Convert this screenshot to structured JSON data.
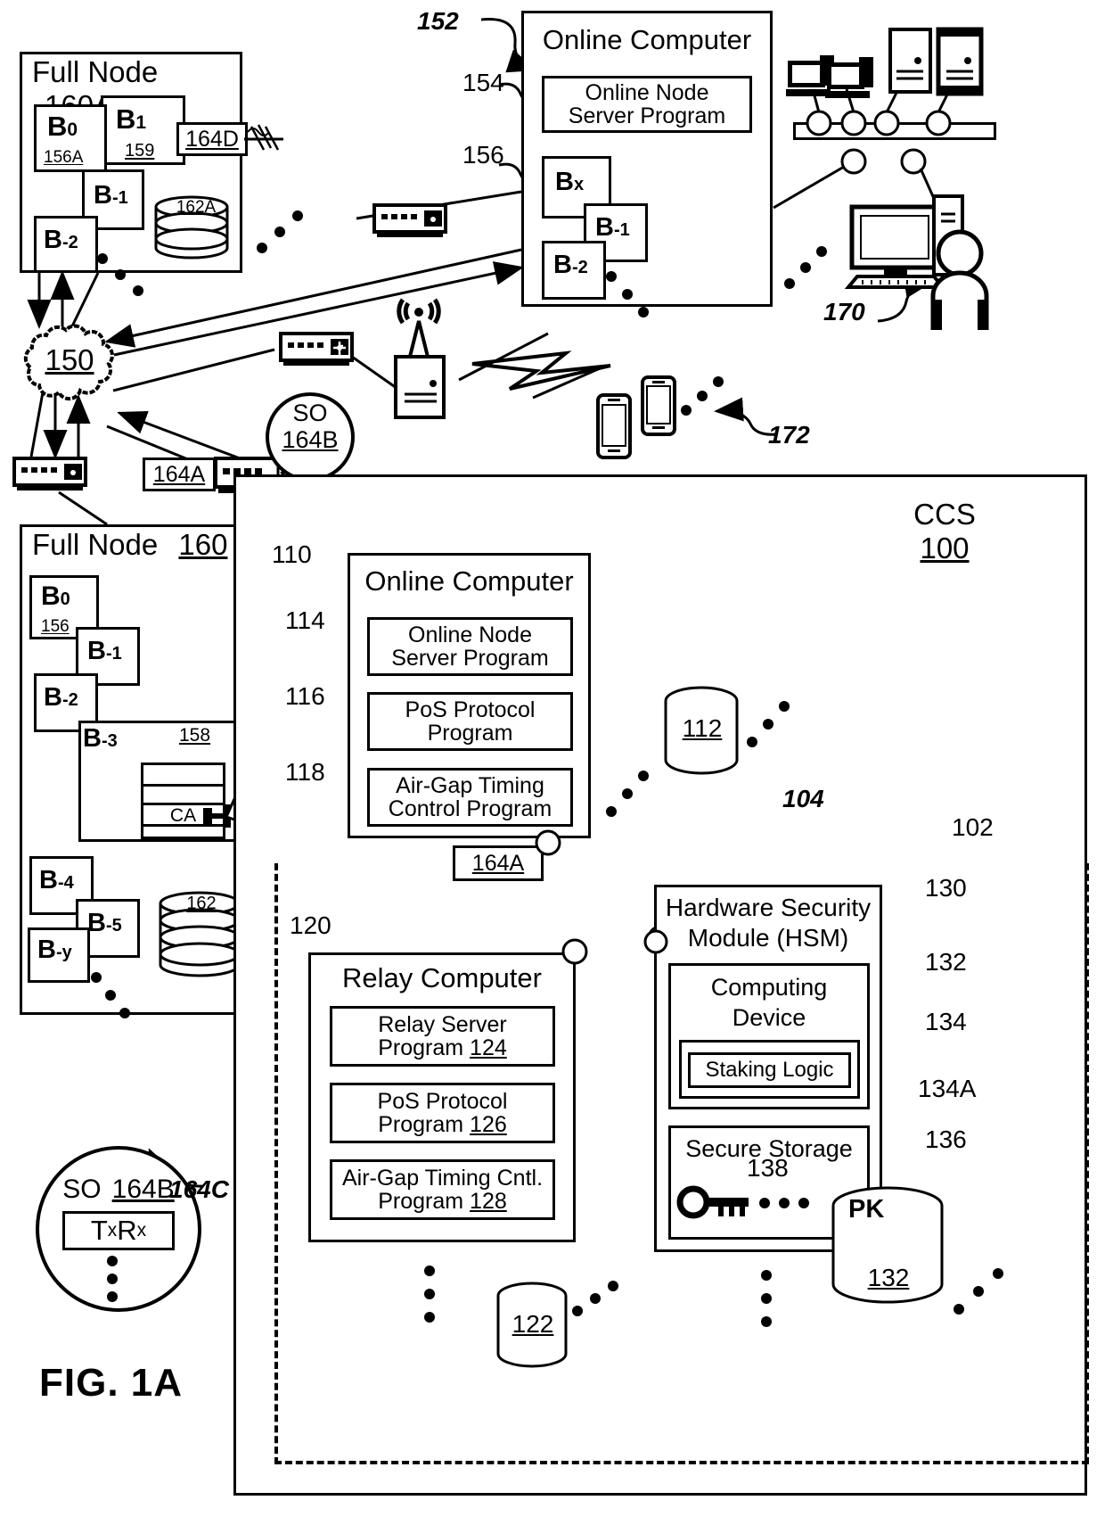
{
  "figure": {
    "label": "FIG. 1A"
  },
  "full_node_a": {
    "title": "Full Node",
    "ref": "160A",
    "blocks": [
      {
        "name": "B",
        "sub": "0",
        "ref": "156A"
      },
      {
        "name": "B",
        "sub": "1",
        "ref": "159"
      },
      {
        "name": "B",
        "sub": "-1",
        "ref": ""
      },
      {
        "name": "B",
        "sub": "-2",
        "ref": ""
      }
    ],
    "so_box": "164D",
    "db_ref": "162A"
  },
  "online_computer_top": {
    "ref": "152",
    "title": "Online Computer",
    "program": {
      "ref": "154",
      "label": "Online Node Server Program"
    },
    "chain_ref": "156",
    "blocks": [
      {
        "name": "B",
        "sub": "x"
      },
      {
        "name": "B",
        "sub": "-1"
      },
      {
        "name": "B",
        "sub": "-2"
      }
    ]
  },
  "network": {
    "cloud_ref": "150",
    "switch_164a": "164A",
    "so_circle": {
      "line1": "SO",
      "line2": "164B"
    }
  },
  "users": {
    "ref": "170"
  },
  "mobile": {
    "ref": "172"
  },
  "full_node_b": {
    "title": "Full Node",
    "ref": "160",
    "blocks": [
      {
        "name": "B",
        "sub": "0",
        "ref": "156"
      },
      {
        "name": "B",
        "sub": "-1",
        "ref": ""
      },
      {
        "name": "B",
        "sub": "-2",
        "ref": ""
      },
      {
        "name": "B",
        "sub": "-3",
        "ref": ""
      },
      {
        "name": "B",
        "sub": "-4",
        "ref": ""
      },
      {
        "name": "B",
        "sub": "-5",
        "ref": ""
      },
      {
        "name": "B",
        "sub": "-y",
        "ref": ""
      }
    ],
    "ledger_ref": "158",
    "ca_label": "CA",
    "db_ref": "162"
  },
  "so_164b_detail": {
    "title": "SO",
    "ref": "164B",
    "txrx": {
      "t": "T",
      "tsub": "x",
      "r": "R",
      "rsub": "x"
    },
    "callout": "164C"
  },
  "ccs": {
    "title": "CCS",
    "ref": "100",
    "airgap_ref": "102",
    "airgap_arrow_ref": "104",
    "switch_164a": "164A",
    "online_computer": {
      "ref": "110",
      "title": "Online Computer",
      "programs": [
        {
          "ref": "114",
          "label": "Online Node Server Program"
        },
        {
          "ref": "116",
          "label": "PoS Protocol Program"
        },
        {
          "ref": "118",
          "label": "Air-Gap Timing Control Program"
        }
      ],
      "db_ref": "112"
    },
    "relay_computer": {
      "ref": "120",
      "title": "Relay Computer",
      "programs": [
        {
          "label": "Relay Server Program",
          "ref": "124"
        },
        {
          "label": "PoS Protocol Program",
          "ref": "126"
        },
        {
          "label": "Air-Gap Timing Cntl. Program",
          "ref": "128"
        }
      ],
      "db_ref": "122"
    },
    "hsm": {
      "ref": "130",
      "title_line1": "Hardware Security",
      "title_line2": "Module (HSM)",
      "computing_device": {
        "ref": "132",
        "title_line1": "Computing",
        "title_line2": "Device",
        "inner_ref": "134",
        "staking_logic": {
          "label": "Staking Logic",
          "ref": "134A"
        }
      },
      "secure_storage": {
        "ref": "136",
        "title": "Secure Storage",
        "key_ref": "138",
        "pk_label": "PK",
        "db_ref": "132"
      }
    }
  }
}
